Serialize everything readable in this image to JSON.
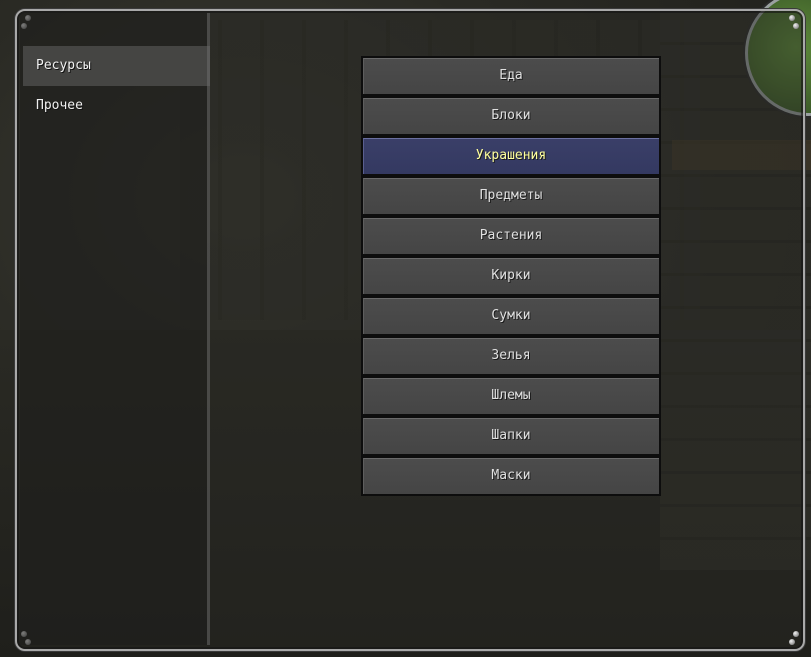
{
  "colors": {
    "button_bg": "#484848",
    "button_selected_bg": "#373c64",
    "button_text": "#e0e0e0",
    "button_selected_text": "#ffff9e",
    "sidebar_active_bg": "#6e6e6e",
    "frame_border": "#a9a9a9"
  },
  "sidebar": {
    "items": [
      {
        "label": "Ресурсы",
        "active": true
      },
      {
        "label": "Прочее",
        "active": false
      }
    ]
  },
  "menu": {
    "selected_index": 2,
    "items": [
      {
        "label": "Еда"
      },
      {
        "label": "Блоки"
      },
      {
        "label": "Украшения"
      },
      {
        "label": "Предметы"
      },
      {
        "label": "Растения"
      },
      {
        "label": "Кирки"
      },
      {
        "label": "Сумки"
      },
      {
        "label": "Зелья"
      },
      {
        "label": "Шлемы"
      },
      {
        "label": "Шапки"
      },
      {
        "label": "Маски"
      }
    ]
  },
  "minimap": {
    "icon": "minimap-icon"
  }
}
